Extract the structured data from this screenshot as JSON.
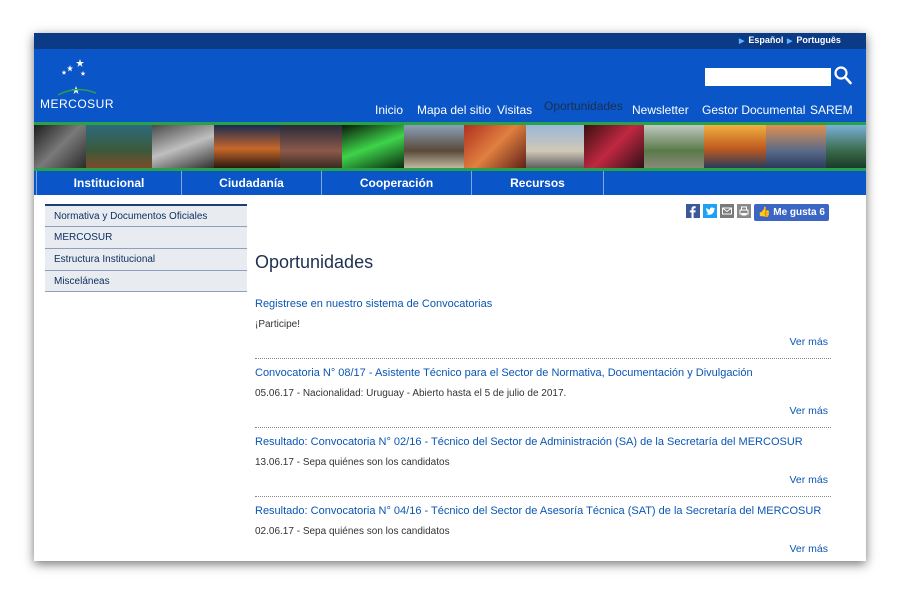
{
  "languages": [
    {
      "label": "Español"
    },
    {
      "label": "Português"
    }
  ],
  "logo": {
    "text": "MERCOSUR"
  },
  "search": {
    "placeholder": ""
  },
  "main_nav": [
    {
      "label": "Inicio",
      "active": false
    },
    {
      "label": "Mapa del sitio",
      "active": false
    },
    {
      "label": "Visitas",
      "active": false
    },
    {
      "label": "Oportunidades",
      "active": true
    },
    {
      "label": "Newsletter",
      "active": false
    },
    {
      "label": "Gestor Documental",
      "active": false
    },
    {
      "label": "SAREM",
      "active": false
    }
  ],
  "secondary_nav": [
    {
      "label": "Institucional"
    },
    {
      "label": "Ciudadanía"
    },
    {
      "label": "Cooperación"
    },
    {
      "label": "Recursos"
    }
  ],
  "sidebar": {
    "items": [
      {
        "label": "Normativa y Documentos Oficiales"
      },
      {
        "label": "MERCOSUR"
      },
      {
        "label": "Estructura Institucional"
      },
      {
        "label": "Misceláneas"
      }
    ]
  },
  "social": {
    "icons": [
      "facebook-icon",
      "twitter-icon",
      "email-icon",
      "print-icon"
    ],
    "like_label": "Me gusta",
    "like_count": "6"
  },
  "page": {
    "title": "Oportunidades"
  },
  "entries": [
    {
      "title": "Registrese en nuestro sistema de Convocatorias",
      "desc": "¡Participe!",
      "more": "Ver más"
    },
    {
      "title": "Convocatoria N° 08/17 - Asistente Técnico para el Sector de Normativa, Documentación y Divulgación",
      "desc": "05.06.17 - Nacionalidad: Uruguay - Abierto hasta el 5 de julio de 2017.",
      "more": "Ver más"
    },
    {
      "title": "Resultado: Convocatoria N° 02/16 - Técnico del Sector de Administración (SA) de la Secretaría del MERCOSUR",
      "desc": "13.06.17 - Sepa quiénes son los candidatos",
      "more": "Ver más"
    },
    {
      "title": "Resultado: Convocatoria N° 04/16 - Técnico del Sector de Asesoría Técnica (SAT) de la Secretaría del MERCOSUR",
      "desc": "02.06.17 - Sepa quiénes son los candidatos",
      "more": "Ver más"
    }
  ],
  "colors": {
    "header_blue": "#0a55c7",
    "topbar_blue": "#0b3a86",
    "accent_green": "#27a24a",
    "link_blue": "#0a56b4",
    "like_blue": "#3b66c4"
  }
}
